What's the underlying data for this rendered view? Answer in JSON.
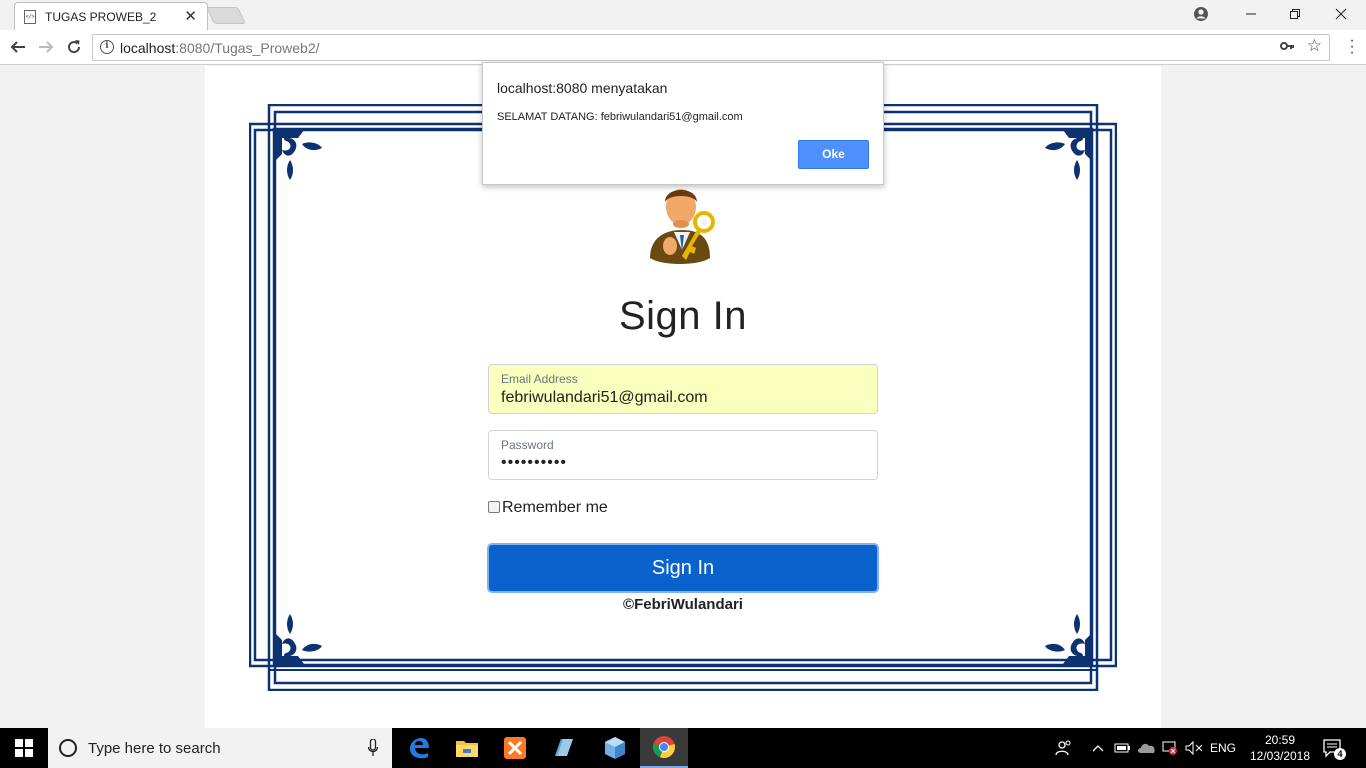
{
  "browser": {
    "tab_title": "TUGAS PROWEB_2",
    "favicon_text": "</>",
    "close_tab": "✕",
    "url_host": "localhost",
    "url_path": ":8080/Tugas_Proweb2/",
    "window_controls": [
      "minimize",
      "restore",
      "close"
    ]
  },
  "dialog": {
    "title": "localhost:8080 menyatakan",
    "message": "SELAMAT DATANG: febriwulandari51@gmail.com",
    "ok_label": "Oke"
  },
  "form": {
    "heading": "Sign In",
    "email_label": "Email Address",
    "email_value": "febriwulandari51@gmail.com",
    "password_label": "Password",
    "password_value": "••••••••••",
    "remember_label": "Remember me",
    "remember_checked": false,
    "submit_label": "Sign In",
    "copyright": "©FebriWulandari"
  },
  "taskbar": {
    "search_placeholder": "Type here to search",
    "apps": [
      "edge-icon",
      "file-explorer-icon",
      "xampp-icon",
      "notepad-icon",
      "virtualbox-icon",
      "chrome-icon"
    ],
    "lang": "ENG",
    "time": "20:59",
    "date": "12/03/2018",
    "notification_count": "4"
  },
  "colors": {
    "frame_blue": "#0c3270",
    "button_blue": "#0a63cd",
    "autofill_yellow": "#faffbd",
    "dialog_button": "#4d90fe"
  }
}
